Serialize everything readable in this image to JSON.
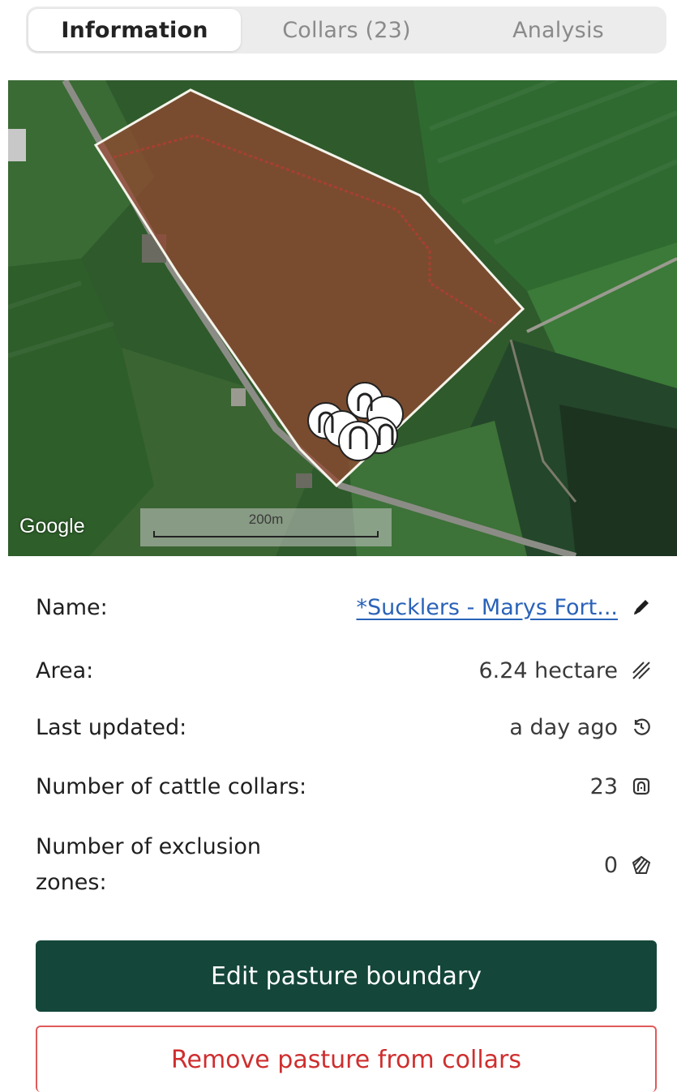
{
  "tabs": [
    {
      "label": "Information",
      "active": true
    },
    {
      "label": "Collars (23)",
      "active": false
    },
    {
      "label": "Analysis",
      "active": false
    }
  ],
  "map": {
    "attribution": "Google",
    "scale_label": "200m"
  },
  "info": {
    "name_label": "Name:",
    "name_value": "*Sucklers - Marys Fort...",
    "area_label": "Area:",
    "area_value": "6.24 hectare",
    "updated_label": "Last updated:",
    "updated_value": "a day ago",
    "collars_label": "Number of cattle collars:",
    "collars_value": "23",
    "exclusion_label": "Number of exclusion zones:",
    "exclusion_value": "0"
  },
  "buttons": {
    "edit_boundary": "Edit pasture boundary",
    "remove_pasture": "Remove pasture from collars"
  },
  "colors": {
    "primary_button": "#14463a",
    "danger_text": "#cf2e2e",
    "link": "#2a62b8"
  }
}
